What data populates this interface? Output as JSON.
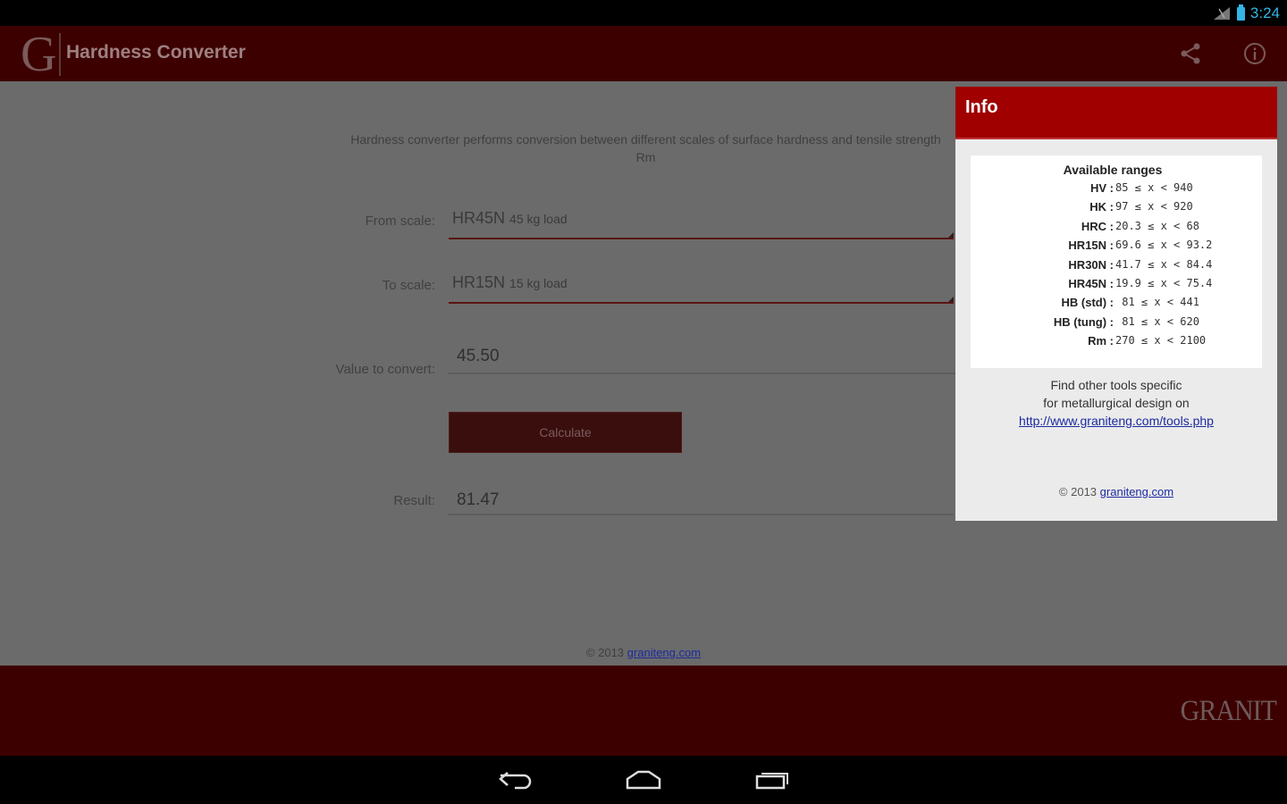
{
  "status_bar": {
    "time": "3:24"
  },
  "app": {
    "logo_letter": "G",
    "title": "Hardness Converter"
  },
  "main": {
    "description": "Hardness converter performs conversion between different scales of surface hardness and tensile strength Rm",
    "from_scale": {
      "label": "From scale:",
      "value": "HR45N",
      "sub": "45 kg load"
    },
    "to_scale": {
      "label": "To scale:",
      "value": "HR15N",
      "sub": "15 kg load"
    },
    "value_to_convert": {
      "label": "Value to convert:",
      "value": "45.50"
    },
    "calculate_label": "Calculate",
    "result": {
      "label": "Result:",
      "value": "81.47"
    },
    "footer": {
      "copyright": "© 2013",
      "link": "graniteng.com"
    }
  },
  "bottom_logo": "GRANIT",
  "info": {
    "title": "Info",
    "ranges_title": "Available ranges",
    "ranges": [
      {
        "label": "HV :",
        "range": "85 ≤ x < 940"
      },
      {
        "label": "HK :",
        "range": "97 ≤ x < 920"
      },
      {
        "label": "HRC :",
        "range": "20.3 ≤ x < 68"
      },
      {
        "label": "HR15N :",
        "range": "69.6 ≤ x < 93.2"
      },
      {
        "label": "HR30N :",
        "range": "41.7 ≤ x < 84.4"
      },
      {
        "label": "HR45N :",
        "range": "19.9 ≤ x < 75.4"
      },
      {
        "label": "HB (std) :",
        "range": " 81 ≤ x < 441"
      },
      {
        "label": "HB (tung) :",
        "range": " 81 ≤ x < 620"
      },
      {
        "label": "Rm :",
        "range": "270 ≤ x < 2100"
      }
    ],
    "find_tools_line1": "Find other tools specific",
    "find_tools_line2": "for metallurgical design on",
    "tools_link": "http://www.graniteng.com/tools.php",
    "copyright": "© 2013",
    "copyright_link": "graniteng.com"
  }
}
